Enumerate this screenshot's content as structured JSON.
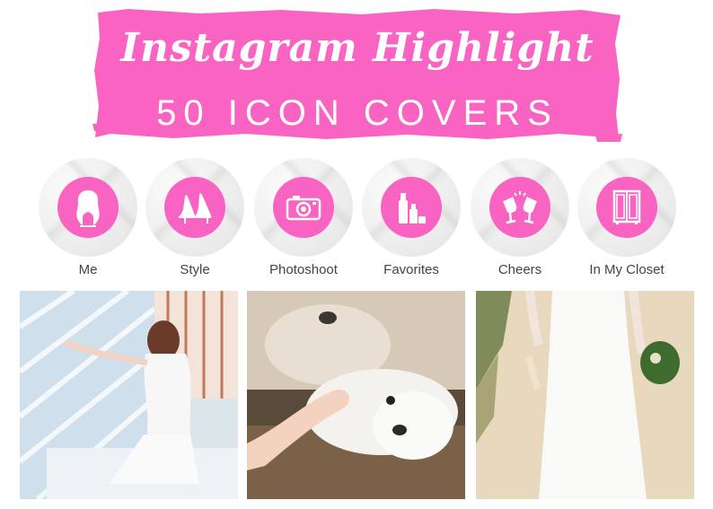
{
  "banner": {
    "title": "Instagram Highlight",
    "subtitle": "50 ICON COVERS",
    "color": "#f963c1"
  },
  "highlights": [
    {
      "label": "Me",
      "icon": "woman-silhouette-icon"
    },
    {
      "label": "Style",
      "icon": "high-heels-icon"
    },
    {
      "label": "Photoshoot",
      "icon": "camera-icon"
    },
    {
      "label": "Favorites",
      "icon": "cosmetics-icon"
    },
    {
      "label": "Cheers",
      "icon": "wine-glasses-icon"
    },
    {
      "label": "In My Closet",
      "icon": "wardrobe-icon"
    }
  ],
  "photos": [
    {
      "subject": "woman-by-window-photo"
    },
    {
      "subject": "white-dog-photo"
    },
    {
      "subject": "bride-on-beach-photo"
    }
  ]
}
